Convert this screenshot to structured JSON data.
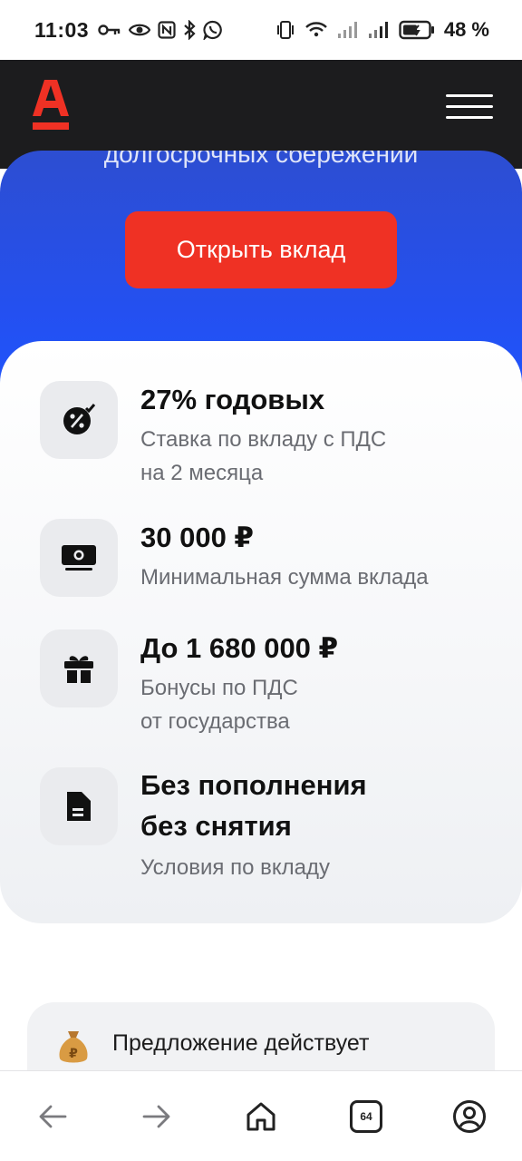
{
  "status_bar": {
    "time": "11:03",
    "battery_percent": "48 %",
    "left_icons": [
      "key-icon",
      "eye-icon",
      "nfc-icon",
      "bluetooth-icon",
      "whatsapp-icon"
    ],
    "right_icons": [
      "vibrate-icon",
      "wifi-icon",
      "signal-icon",
      "signal-icon",
      "battery-icon"
    ]
  },
  "header": {
    "logo": "alfa-logo",
    "menu_icon": "hamburger-menu-icon"
  },
  "hero": {
    "partial_text": "долгосрочных сбережений",
    "cta_label": "Открыть вклад",
    "cta_color": "#ef3124",
    "background_color": "#2450f0"
  },
  "features": [
    {
      "icon": "percent-badge-icon",
      "title": "27% годовых",
      "subtitle": "Ставка по вкладу с ПДС\nна 2 месяца"
    },
    {
      "icon": "banknote-icon",
      "title": "30 000 ₽",
      "subtitle": "Минимальная сумма вклада"
    },
    {
      "icon": "gift-icon",
      "title": "До 1 680 000 ₽",
      "subtitle": "Бонусы по ПДС\nот государства"
    },
    {
      "icon": "document-icon",
      "title": "Без пополнения\nбез снятия",
      "subtitle": "Условия по вкладу"
    }
  ],
  "promo": {
    "icon": "money-bag-icon",
    "text": "Предложение действует"
  },
  "browser_nav": {
    "back_icon": "arrow-left-icon",
    "forward_icon": "arrow-right-icon",
    "home_icon": "home-icon",
    "tabs_count": "64",
    "profile_icon": "profile-icon"
  }
}
